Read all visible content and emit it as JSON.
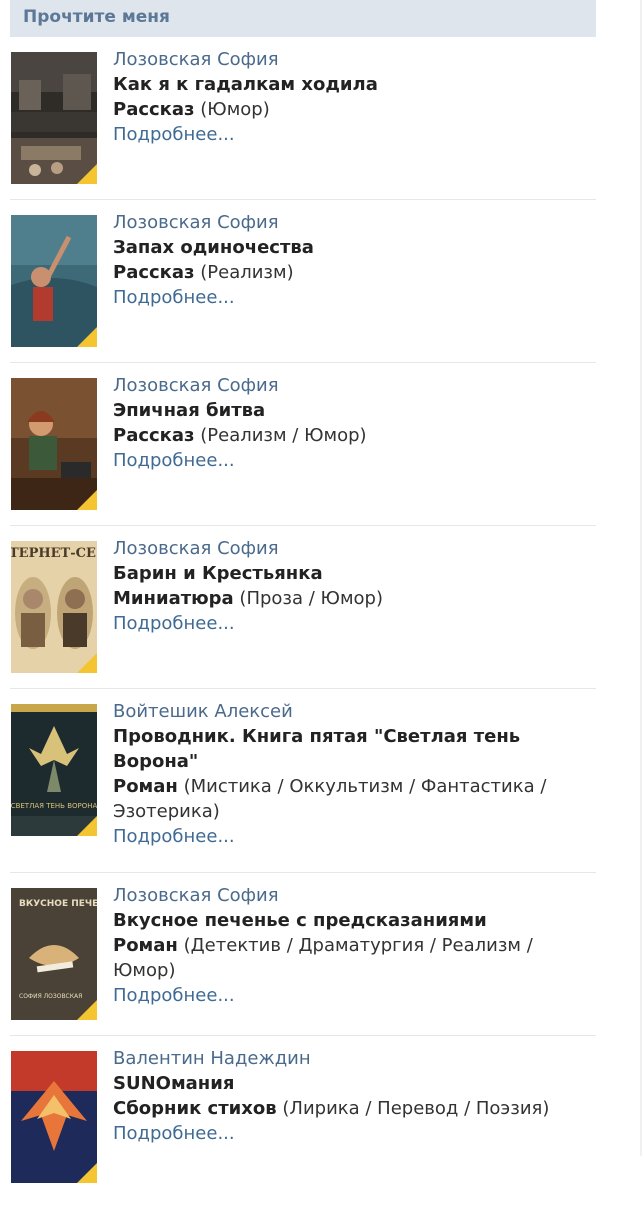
{
  "section_title": "Прочтите меня",
  "more_label": "Подробнее...",
  "items": [
    {
      "author": "Лозовская София",
      "title": "Как я к гадалкам ходила",
      "form": "Рассказ",
      "genres": "(Юмор)",
      "cover_icon": "cover-dark-street"
    },
    {
      "author": "Лозовская София",
      "title": "Запах одиночества",
      "form": "Рассказ",
      "genres": "(Реализм)",
      "cover_icon": "cover-woman-blue"
    },
    {
      "author": "Лозовская София",
      "title": "Эпичная битва",
      "form": "Рассказ",
      "genres": "(Реализм / Юмор)",
      "cover_icon": "cover-woman-cafe"
    },
    {
      "author": "Лозовская София",
      "title": "Барин и Крестьянка",
      "form": "Миниатюра",
      "genres": "(Проза / Юмор)",
      "cover_icon": "cover-two-portraits",
      "cover_text": "ТЕРНЕТ-СЕ"
    },
    {
      "author": "Войтешик Алексей",
      "title": "Проводник. Книга пятая \"Светлая тень Ворона\"",
      "form": "Роман",
      "genres": "(Мистика / Оккультизм / Фантастика / Эзотерика)",
      "cover_icon": "cover-raven",
      "cover_text": "СВЕТЛАЯ ТЕНЬ ВОРОНА"
    },
    {
      "author": "Лозовская София",
      "title": "Вкусное печенье с предсказаниями",
      "form": "Роман",
      "genres": "(Детектив / Драматургия / Реализм / Юмор)",
      "cover_icon": "cover-fortune-cookie",
      "cover_text": "ВКУСНОЕ ПЕЧЕНЬЕ",
      "cover_author": "СОФИЯ ЛОЗОВСКАЯ"
    },
    {
      "author": "Валентин Надеждин",
      "title": "SUNOмания",
      "form": "Сборник стихов",
      "genres": "(Лирика / Перевод / Поэзия)",
      "cover_icon": "cover-phoenix"
    }
  ],
  "colors": {
    "header_bg": "#dfe5ec",
    "header_text": "#5b7896",
    "link": "#3f6a94",
    "badge": "#f5c431"
  }
}
